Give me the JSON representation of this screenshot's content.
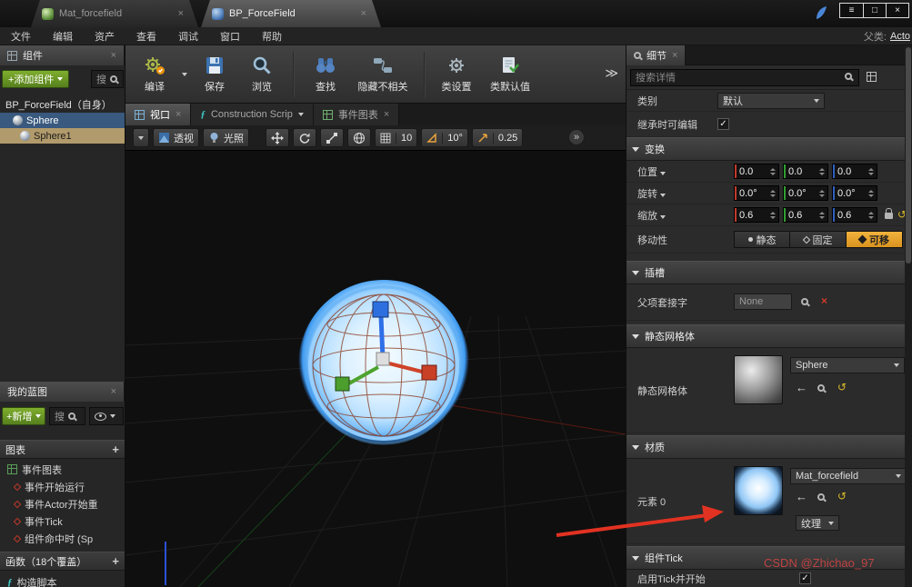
{
  "glyphs": {
    "close": "×",
    "plus": "+",
    "check": "✓",
    "back": "←",
    "reset": "↺",
    "clear": "×",
    "fn": "ƒ",
    "overflow": "≫",
    "more": "»"
  },
  "titlebar": {
    "tabs": [
      {
        "label": "Mat_forcefield"
      },
      {
        "label": "BP_ForceField"
      }
    ],
    "window_controls": [
      "≡",
      "□",
      "×"
    ]
  },
  "menubar": {
    "items": [
      "文件",
      "编辑",
      "资产",
      "查看",
      "调试",
      "窗口",
      "帮助"
    ],
    "parent_label": "父类:",
    "parent_value": "Acto"
  },
  "components": {
    "title": "组件",
    "add": "+添加组件",
    "search": "搜",
    "items": [
      {
        "label": "BP_ForceField（自身）"
      },
      {
        "label": "Sphere"
      },
      {
        "label": "Sphere1"
      }
    ]
  },
  "my_blueprint": {
    "title": "我的蓝图",
    "add": "+新增",
    "search": "搜",
    "graphs_header": "图表",
    "items": [
      {
        "label": "事件图表"
      },
      {
        "label": "事件开始运行"
      },
      {
        "label": "事件Actor开始重"
      },
      {
        "label": "事件Tick"
      },
      {
        "label": "组件命中时 (Sp"
      }
    ],
    "functions_header": "函数（18个覆盖）",
    "construction": "构造脚本"
  },
  "toolbar": {
    "compile": "编译",
    "save": "保存",
    "browse": "浏览",
    "find": "查找",
    "hide_unrelated": "隐藏不相关",
    "class_settings": "类设置",
    "class_defaults": "类默认值"
  },
  "viewport": {
    "tabs": [
      {
        "label": "视口"
      },
      {
        "label": "Construction Scrip"
      },
      {
        "label": "事件图表"
      }
    ],
    "perspective": "透视",
    "lit": "光照",
    "grid_snap": "10",
    "angle_snap": "10°",
    "scale_snap": "0.25"
  },
  "details": {
    "title": "细节",
    "search_placeholder": "搜索详情",
    "category_label": "类别",
    "category_value": "默认",
    "inherit_editable": "继承时可编辑",
    "transform": {
      "header": "变换",
      "location_label": "位置",
      "location": [
        "0.0",
        "0.0",
        "0.0"
      ],
      "rotation_label": "旋转",
      "rotation": [
        "0.0°",
        "0.0°",
        "0.0°"
      ],
      "scale_label": "缩放",
      "scale": [
        "0.6",
        "0.6",
        "0.6"
      ],
      "mobility_label": "移动性",
      "mobility_static": "静态",
      "mobility_stationary": "固定",
      "mobility_movable": "可移"
    },
    "sockets": {
      "header": "插槽",
      "parent_socket_label": "父项套接字",
      "parent_socket_value": "None"
    },
    "static_mesh": {
      "header": "静态网格体",
      "label": "静态网格体",
      "value": "Sphere"
    },
    "materials": {
      "header": "材质",
      "element_label": "元素 0",
      "value": "Mat_forcefield",
      "texture_label": "纹理"
    },
    "tick": {
      "header": "组件Tick",
      "start_label": "启用Tick并开始"
    }
  },
  "watermark": "CSDN @Zhichao_97"
}
